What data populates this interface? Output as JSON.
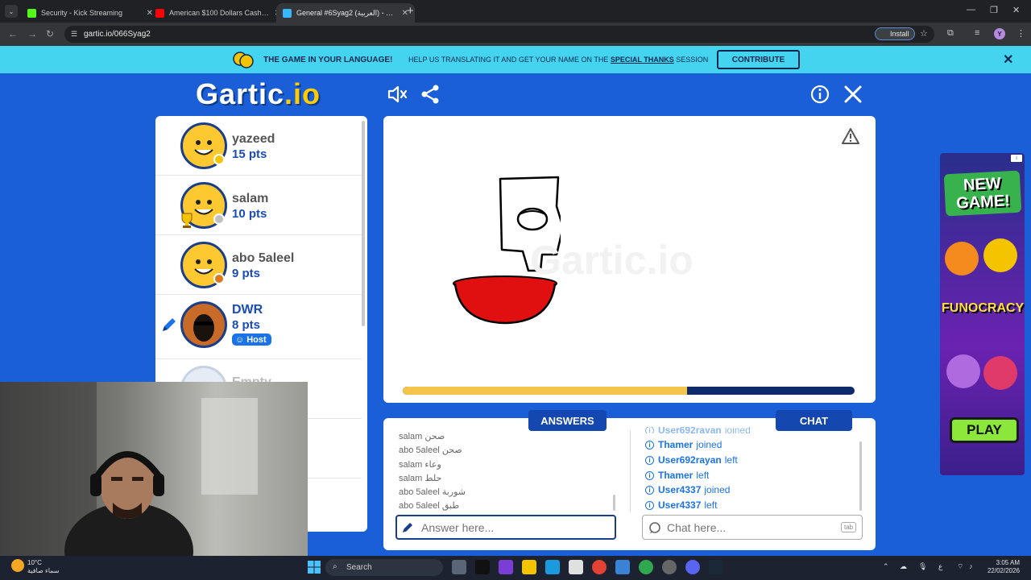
{
  "browser": {
    "tabs": [
      {
        "title": "Security - Kick Streaming",
        "favicon_color": "#53fc18"
      },
      {
        "title": "American $100 Dollars Cash Bi",
        "favicon_color": "#ff0000"
      },
      {
        "title": "General #6Syag2 (العربية) - Gar",
        "favicon_color": "#38b6ff"
      }
    ],
    "url": "gartic.io/066Syag2",
    "install_label": "Install",
    "profile_initial": "Y"
  },
  "banner": {
    "lead": "THE GAME IN YOUR LANGUAGE!",
    "sub_before": "HELP US TRANSLATING IT AND GET YOUR NAME ON THE",
    "sub_link": "SPECIAL THANKS",
    "sub_after": "SESSION",
    "button": "CONTRIBUTE"
  },
  "game": {
    "logo_main": "Gartic",
    "logo_suffix": ".io",
    "players": [
      {
        "name": "yazeed",
        "points": "15 pts",
        "badge_color": "#f5c400"
      },
      {
        "name": "salam",
        "points": "10 pts",
        "badge_color": "#c0c0c0"
      },
      {
        "name": "abo 5aleel",
        "points": "9 pts",
        "badge_color": "#d97a1e"
      },
      {
        "name": "DWR",
        "points": "8 pts",
        "tag": "Host"
      },
      {
        "name": "Empty",
        "points": ""
      }
    ],
    "drawing_progress": 0.63,
    "tabs": {
      "answers": "ANSWERS",
      "chat": "CHAT"
    },
    "answers": [
      {
        "user": "salam",
        "text": "صحن"
      },
      {
        "user": "abo 5aleel",
        "text": "صحن"
      },
      {
        "user": "salam",
        "text": "وعاء"
      },
      {
        "user": "salam",
        "text": "حلط"
      },
      {
        "user": "abo 5aleel",
        "text": "شوربة"
      },
      {
        "user": "abo 5aleel",
        "text": "طبق"
      }
    ],
    "chat": [
      {
        "user": "User692rayan",
        "event": "joined"
      },
      {
        "user": "Thamer",
        "event": "joined"
      },
      {
        "user": "User692rayan",
        "event": "left"
      },
      {
        "user": "Thamer",
        "event": "left"
      },
      {
        "user": "User4337",
        "event": "joined"
      },
      {
        "user": "User4337",
        "event": "left"
      }
    ],
    "answer_placeholder": "Answer here...",
    "chat_placeholder": "Chat here...",
    "tab_key": "tab"
  },
  "ad": {
    "headline": "NEW GAME!",
    "brand": "FUNOCRACY",
    "cta": "PLAY"
  },
  "taskbar": {
    "temperature": "10°C",
    "weather": "سماء صافية",
    "search": "Search",
    "time": "3:05 AM",
    "date": "22/02/2026",
    "lang": "ع"
  }
}
